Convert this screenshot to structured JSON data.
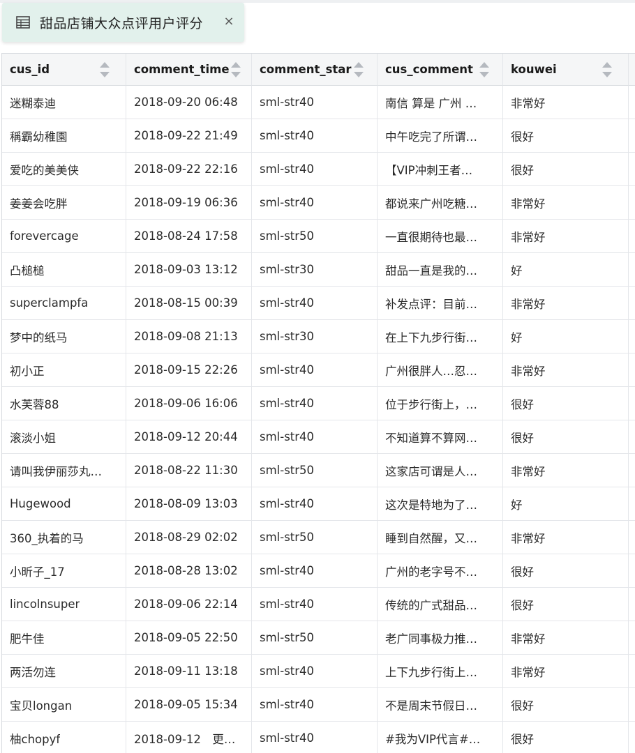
{
  "tab": {
    "title": "甜品店铺大众点评用户评分",
    "close_label": "×"
  },
  "table": {
    "columns": [
      "cus_id",
      "comment_time",
      "comment_star",
      "cus_comment",
      "kouwei"
    ],
    "rows": [
      [
        "迷糊泰迪",
        "2018-09-20 06:48",
        "sml-str40",
        "南信 算是 广州 …",
        "非常好"
      ],
      [
        "稱霸幼稚園",
        "2018-09-22 21:49",
        "sml-str40",
        "中午吃完了所谓…",
        "很好"
      ],
      [
        "爱吃的美美侠",
        "2018-09-22 22:16",
        "sml-str40",
        "【VIP冲刺王者…",
        "很好"
      ],
      [
        "姜姜会吃胖",
        "2018-09-19 06:36",
        "sml-str40",
        "都说来广州吃糖…",
        "非常好"
      ],
      [
        "forevercage",
        "2018-08-24 17:58",
        "sml-str50",
        "一直很期待也最…",
        "非常好"
      ],
      [
        "凸槌槌",
        "2018-09-03 13:12",
        "sml-str30",
        "甜品一直是我的…",
        "好"
      ],
      [
        "superclampfa",
        "2018-08-15 00:39",
        "sml-str40",
        "补发点评：目前…",
        "非常好"
      ],
      [
        "梦中的纸马",
        "2018-09-08 21:13",
        "sml-str30",
        "在上下九步行街…",
        "好"
      ],
      [
        "初小正",
        "2018-09-15 22:26",
        "sml-str40",
        "广州很胖人…忍…",
        "非常好"
      ],
      [
        "水芙蓉88",
        "2018-09-06 16:06",
        "sml-str40",
        "位于步行街上，…",
        "很好"
      ],
      [
        "滚淡小姐",
        "2018-09-12 20:44",
        "sml-str40",
        "不知道算不算网…",
        "很好"
      ],
      [
        "请叫我伊丽莎丸…",
        "2018-08-22 11:30",
        "sml-str50",
        "这家店可谓是人…",
        "非常好"
      ],
      [
        "Hugewood",
        "2018-08-09 13:03",
        "sml-str40",
        "这次是特地为了…",
        "好"
      ],
      [
        "360_执着的马",
        "2018-08-29 02:02",
        "sml-str50",
        "睡到自然醒，又…",
        "非常好"
      ],
      [
        "小昕子_17",
        "2018-08-28 13:02",
        "sml-str40",
        "广州的老字号不…",
        "很好"
      ],
      [
        "lincolnsuper",
        "2018-09-06 22:14",
        "sml-str40",
        "传统的广式甜品…",
        "很好"
      ],
      [
        "肥牛佳",
        "2018-09-05 22:50",
        "sml-str50",
        "老广同事极力推…",
        "非常好"
      ],
      [
        "两活勿连",
        "2018-09-11 13:18",
        "sml-str40",
        "上下九步行街上…",
        "非常好"
      ],
      [
        "宝贝longan",
        "2018-09-05 15:34",
        "sml-str40",
        "不是周末节假日…",
        "很好"
      ],
      [
        "柚chopyf",
        "2018-09-12　更…",
        "sml-str40",
        "#我为VIP代言#…",
        "很好"
      ]
    ]
  },
  "icons": {
    "tab_icon": "table-icon",
    "sort_icon": "sort-arrows-icon"
  },
  "colors": {
    "tab_bg": "#e2f1ec",
    "header_bg": "#f5f6f7",
    "grid_line": "#e4e6ea"
  }
}
